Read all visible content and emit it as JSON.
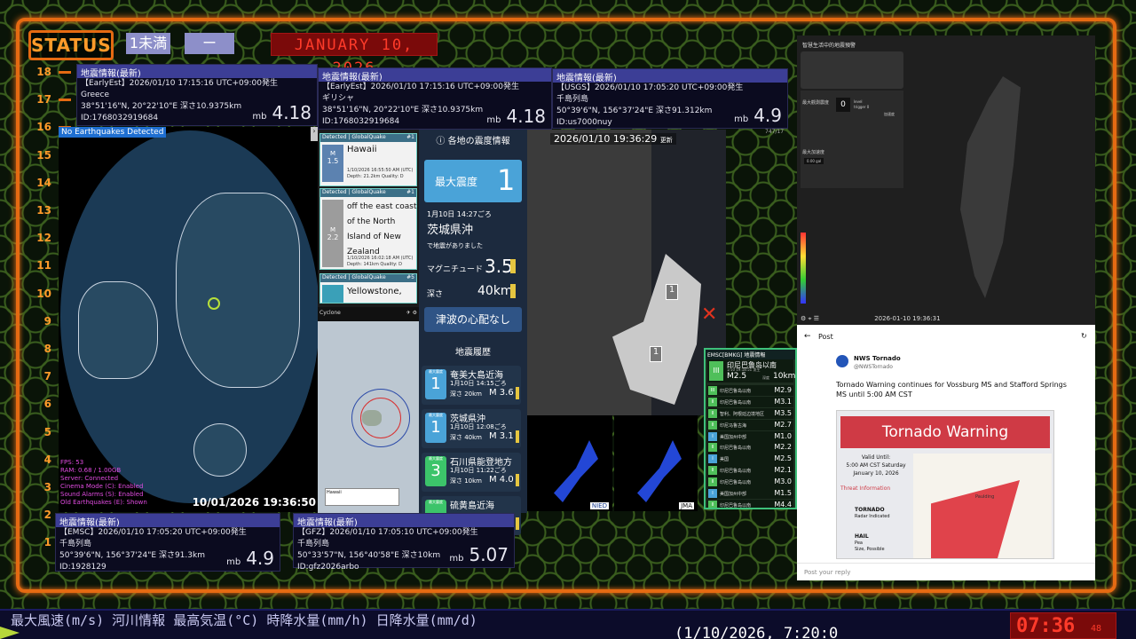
{
  "status": {
    "label": "STATUS",
    "level": "1未満",
    "dash": "ー",
    "date": "JANUARY 10, 2026"
  },
  "scale": [
    "18",
    "17",
    "16",
    "15",
    "14",
    "13",
    "12",
    "11",
    "10",
    "9",
    "8",
    "7",
    "6",
    "5",
    "4",
    "3",
    "2",
    "1"
  ],
  "quake_cards": {
    "greece_en": {
      "header": "地震情報(最新)",
      "line1": "【EarlyEst】2026/01/10  17:15:16  UTC+09:00発生",
      "line2": "Greece",
      "line3": "38°51'16\"N, 20°22'10\"E  深さ10.9375km",
      "line4": "ID:1768032919684",
      "mag_unit": "mb",
      "mag": "4.18"
    },
    "greece_jp": {
      "header": "地震情報(最新)",
      "line1": "【EarlyEst】2026/01/10  17:15:16  UTC+09:00発生",
      "line2": "ギリシャ",
      "line3": "38°51'16\"N, 20°22'10\"E  深さ10.9375km",
      "line4": "ID:1768032919684",
      "mag_unit": "mb",
      "mag": "4.18"
    },
    "usgs": {
      "header": "地震情報(最新)",
      "line1": "【USGS】2026/01/10  17:05:20  UTC+09:00発生",
      "line2": "千島列島",
      "line3": "50°39'6\"N, 156°37'24\"E  深さ91.312km",
      "line4": "ID:us7000nuy",
      "mag_unit": "mb",
      "mag": "4.9"
    },
    "emsc": {
      "header": "地震情報(最新)",
      "line1": "【EMSC】2026/01/10  17:05:20  UTC+09:00発生",
      "line2": "千島列島",
      "line3": "50°39'6\"N, 156°37'24\"E  深さ91.3km",
      "line4": "ID:1928129",
      "mag_unit": "mb",
      "mag": "4.9"
    },
    "gfz": {
      "header": "地震情報(最新)",
      "line1": "【GFZ】2026/01/10  17:05:10  UTC+09:00発生",
      "line2": "千島列島",
      "line3": "50°33'57\"N, 156°40'58\"E  深さ10km",
      "line4": "ID:gfz2026arbo",
      "mag_unit": "mb",
      "mag": "5.07"
    }
  },
  "globe": {
    "badge": "No Earthquakes Detected",
    "timestamp": "10/01/2026 19:36:50",
    "stats": [
      "FPS: 53",
      "RAM: 0.68 / 1.00GB",
      "Server: Connected",
      "Cinema Mode (C): Enabled",
      "Sound Alarms (S): Enabled",
      "Old Earthquakes (E): Shown"
    ]
  },
  "globalquake": {
    "items": [
      {
        "header": "Detected | GlobalQuake",
        "num": "#1",
        "mag_label": "M",
        "mag": "1.5",
        "place": "Hawaii",
        "detail1": "1/10/2026 16:55:50 AM (UTC)",
        "detail2": "Depth: 21.2km   Quality: D"
      },
      {
        "header": "Detected | GlobalQuake",
        "num": "#1",
        "mag_label": "M",
        "mag": "2.2",
        "place": "off the east coast of the North Island of New Zealand",
        "detail1": "1/10/2026 16:02:18 AM (UTC)",
        "detail2": "Depth: 141km   Quality: D"
      },
      {
        "header": "Detected | GlobalQuake",
        "num": "#5",
        "mag_label": "",
        "mag": "",
        "place": "Yellowstone,",
        "detail1": "",
        "detail2": ""
      }
    ],
    "map_title": "Cyclone",
    "map_caption": "Hawaii"
  },
  "jma": {
    "title": "各地の震度情報",
    "max_label": "最大震度",
    "max_value": "1",
    "time": "1月10日 14:27ごろ",
    "area": "茨城県沖",
    "note": "で地震がありました",
    "mag_label": "マグニチュード",
    "mag": "3.5",
    "depth_label": "深さ",
    "depth": "40km",
    "tsunami": "津波の心配なし",
    "history_title": "地震履歴",
    "history": [
      {
        "intensity": "1",
        "place": "奄美大島近海",
        "time": "1月10日 14:15ごろ",
        "depth": "深さ 20km",
        "mag": "M 3.6",
        "color": "#4aa3d8"
      },
      {
        "intensity": "1",
        "place": "茨城県沖",
        "time": "1月10日 12:08ごろ",
        "depth": "深さ 40km",
        "mag": "M 3.1",
        "color": "#4aa3d8"
      },
      {
        "intensity": "3",
        "place": "石川県能登地方",
        "time": "1月10日 11:22ごろ",
        "depth": "深さ 10km",
        "mag": "M 4.0",
        "color": "#3cc46a"
      },
      {
        "intensity": "",
        "place": "硫黄島近海",
        "time": "",
        "depth": "",
        "mag": "",
        "color": "#3cc46a"
      }
    ]
  },
  "kanto_map": {
    "timestamp": "2026/01/10  19:36:29",
    "update_label": "更新",
    "marker1": "1",
    "marker2": "1",
    "nied_label": "NIED",
    "jma_label": "JMA"
  },
  "emsc_list": {
    "header": "EMSC[BMKG] 地震情報",
    "top_place": "印尼巴鲁岛以南",
    "top_intensity": "III",
    "top_time": "1/10 19:18:51 发生",
    "top_mag": "M2.5",
    "top_depth": "10km",
    "top_depth_label": "深度",
    "rows": [
      {
        "intensity": "III",
        "place": "印尼巴鲁岛以南",
        "mag": "M2.9",
        "color": "#4fbf5a"
      },
      {
        "intensity": "II",
        "place": "印尼巴鲁岛以南",
        "mag": "M3.1",
        "color": "#4fbf5a"
      },
      {
        "intensity": "II",
        "place": "智利、阿根廷边境地区",
        "mag": "M3.5",
        "color": "#4fbf5a"
      },
      {
        "intensity": "II",
        "place": "印尼马鲁古海",
        "mag": "M2.7",
        "color": "#4fbf5a"
      },
      {
        "intensity": "I",
        "place": "美国加州中部",
        "mag": "M1.0",
        "color": "#4aa3d8"
      },
      {
        "intensity": "II",
        "place": "印尼巴鲁岛以南",
        "mag": "M2.2",
        "color": "#4fbf5a"
      },
      {
        "intensity": "I",
        "place": "美国",
        "mag": "M2.5",
        "color": "#4aa3d8"
      },
      {
        "intensity": "II",
        "place": "印尼巴鲁岛以南",
        "mag": "M2.1",
        "color": "#4fbf5a"
      },
      {
        "intensity": "II",
        "place": "印尼巴鲁岛以南",
        "mag": "M3.0",
        "color": "#4fbf5a"
      },
      {
        "intensity": "I",
        "place": "美国加州中部",
        "mag": "M1.5",
        "color": "#4aa3d8"
      },
      {
        "intensity": "II",
        "place": "印尼巴鲁岛以南",
        "mag": "M4.4",
        "color": "#4fbf5a"
      }
    ]
  },
  "taiwan": {
    "title": "智慧生活中的地震預警",
    "max_label": "最大觀測震度",
    "max_value": "0",
    "level_label": "level",
    "trigger_label": "trigger",
    "trigger_value": "0",
    "accel_label": "最大加速度",
    "accel_value": "0.00 gal",
    "status_label": "加速度",
    "timestamp": "2026-01-10 19:36:31"
  },
  "tweet": {
    "back": "←",
    "post_label": "Post",
    "account": "NWS Tornado",
    "handle": "@NWSTornado",
    "text": "Tornado Warning continues for Vossburg MS and  Stafford Springs MS until 5:00 AM CST",
    "card_title": "Tornado Warning",
    "valid_label": "Valid Until:",
    "valid_time": "5:00 AM CST Saturday",
    "valid_date": "January 10, 2026",
    "threat_label": "Threat Information",
    "tornado_label": "TORNADO",
    "tornado_detail": "Radar Indicated",
    "hail_label": "HAIL",
    "hail_detail1": "Pea",
    "hail_detail2": "Size, Possible",
    "place_label": "Paulding",
    "reply_placeholder": "Post your reply"
  },
  "ticker": {
    "top": "最大風速(m/s)  河川情報       最高気温(°C)     時降水量(mm/h)   日降水量(mm/d)",
    "bottom": "(1/10/2026,  7:20:0",
    "clock": "07:36",
    "clock_sec": "48"
  }
}
